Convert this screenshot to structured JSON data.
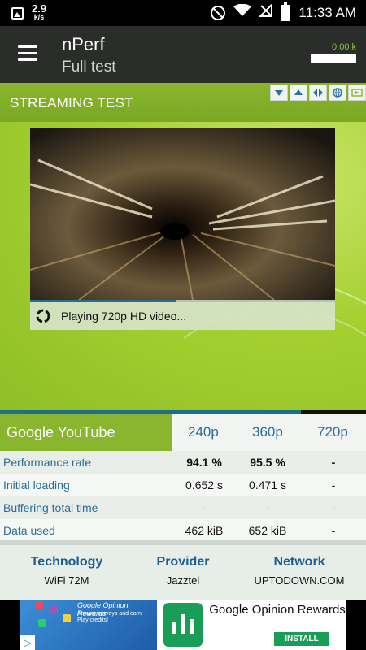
{
  "status_bar": {
    "speed_value": "2.9",
    "speed_unit": "k/s",
    "time": "11:33 AM",
    "icons": [
      "gallery-icon",
      "block-icon",
      "wifi-icon",
      "no-signal-icon",
      "battery-icon"
    ]
  },
  "app_bar": {
    "title": "nPerf",
    "subtitle": "Full test",
    "data_counter": "0.00 k",
    "icons": [
      "menu-icon"
    ]
  },
  "streaming": {
    "title": "STREAMING TEST",
    "controls": [
      "arrow-down-icon",
      "arrow-up-icon",
      "arrows-left-right-icon",
      "globe-icon",
      "video-icon"
    ],
    "status_text": "Playing 720p HD video...",
    "progress": 0.48
  },
  "results": {
    "service": "Google YouTube",
    "columns": [
      "240p",
      "360p",
      "720p"
    ],
    "rows": [
      {
        "label": "Performance rate",
        "values": [
          "94.1 %",
          "95.5 %",
          "-"
        ]
      },
      {
        "label": "Initial loading",
        "values": [
          "0.652 s",
          "0.471 s",
          "-"
        ]
      },
      {
        "label": "Buffering total time",
        "values": [
          "-",
          "-",
          "-"
        ]
      },
      {
        "label": "Data used",
        "values": [
          "462 kiB",
          "652 kiB",
          "-"
        ]
      }
    ]
  },
  "info": {
    "technology_label": "Technology",
    "technology_value": "WiFi 72M",
    "provider_label": "Provider",
    "provider_value": "Jazztel",
    "network_label": "Network",
    "network_value": "UPTODOWN.COM"
  },
  "ad": {
    "left_title": "Google Opinion Rewards",
    "left_text": "Answer surveys and earn Play credits!",
    "title": "Google Opinion Rewards",
    "install_label": "INSTALL"
  },
  "colors": {
    "accent_green": "#8ab52f",
    "link_blue": "#2b6c9a",
    "app_bar": "#2b2d2b",
    "install_green": "#1a9e57"
  }
}
